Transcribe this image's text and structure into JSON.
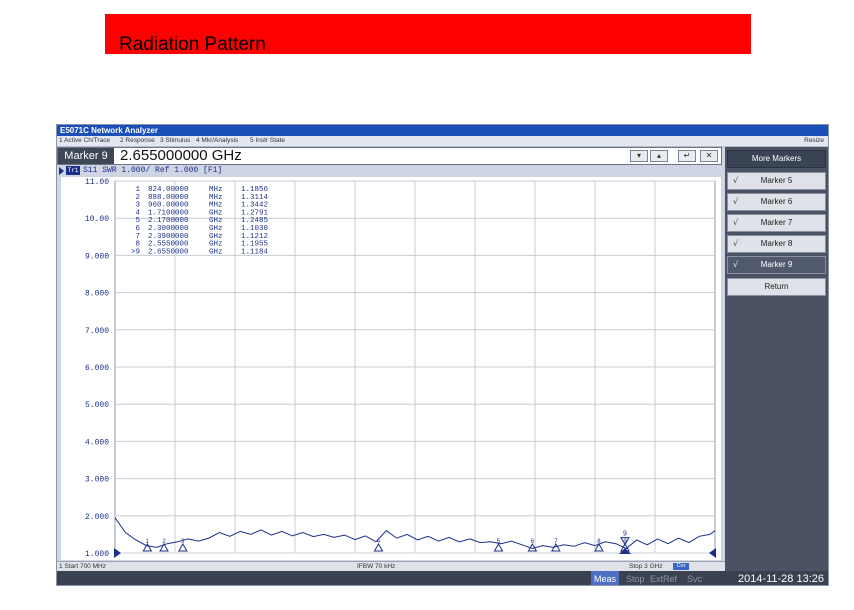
{
  "slide": {
    "title": "Radiation   Pattern"
  },
  "window": {
    "title": "E5071C Network Analyzer",
    "resize_label": "Resize"
  },
  "menu": [
    "1 Active Ch/Trace",
    "2 Response",
    "3 Stimulus",
    "4 Mkr/Analysis",
    "5 Instr State"
  ],
  "entry": {
    "label": "Marker 9",
    "value": "2.655000000 GHz"
  },
  "softkeys": {
    "title": "More Markers",
    "items": [
      {
        "check": "√",
        "label": "Marker 5",
        "active": false
      },
      {
        "check": "√",
        "label": "Marker 6",
        "active": false
      },
      {
        "check": "√",
        "label": "Marker 7",
        "active": false
      },
      {
        "check": "√",
        "label": "Marker 8",
        "active": false
      },
      {
        "check": "√",
        "label": "Marker 9",
        "active": true
      }
    ],
    "return_label": "Return"
  },
  "trace": {
    "badge": "Tr1",
    "header_text": "S11  SWR 1.000/ Ref 1.000 [F1]"
  },
  "markers_table": [
    {
      "num": "1",
      "freq": "824.00000",
      "unit": "MHz",
      "value": "1.1856"
    },
    {
      "num": "2",
      "freq": "888.00000",
      "unit": "MHz",
      "value": "1.3114"
    },
    {
      "num": "3",
      "freq": "960.00000",
      "unit": "MHz",
      "value": "1.3442"
    },
    {
      "num": "4",
      "freq": "1.7100000",
      "unit": "GHz",
      "value": "1.2791"
    },
    {
      "num": "5",
      "freq": "2.1700000",
      "unit": "GHz",
      "value": "1.2485"
    },
    {
      "num": "6",
      "freq": "2.3000000",
      "unit": "GHz",
      "value": "1.1030"
    },
    {
      "num": "7",
      "freq": "2.3900000",
      "unit": "GHz",
      "value": "1.1212"
    },
    {
      "num": "8",
      "freq": "2.5550000",
      "unit": "GHz",
      "value": "1.1955"
    },
    {
      "num": ">9",
      "freq": "2.6550000",
      "unit": "GHz",
      "value": "1.1184"
    }
  ],
  "status": {
    "start": "1  Start 700 MHz",
    "ifbw": "IFBW 70 kHz",
    "stop": "Stop 3 GHz",
    "cor": "Cor"
  },
  "bottom": {
    "meas": "Meas",
    "indicators": [
      "Stop",
      "ExtRef",
      "Svc"
    ],
    "datetime": "2014-11-28 13:26"
  },
  "chart_data": {
    "type": "line",
    "title": "",
    "xlabel": "",
    "ylabel": "",
    "x_unit": "GHz",
    "xlim": [
      0.7,
      3.0
    ],
    "ylim": [
      1.0,
      11.0
    ],
    "y_ticks": [
      11.0,
      10.0,
      9.0,
      8.0,
      7.0,
      6.0,
      5.0,
      4.0,
      3.0,
      2.0,
      1.0
    ],
    "y_tick_labels": [
      "11.00",
      "10.00",
      "9.000",
      "8.000",
      "7.000",
      "6.000",
      "5.000",
      "4.000",
      "3.000",
      "2.000",
      "1.000"
    ],
    "grid": true,
    "series": [
      {
        "color": "#1c2f8a",
        "x": [
          0.7,
          0.74,
          0.78,
          0.82,
          0.86,
          0.9,
          0.94,
          0.98,
          1.02,
          1.06,
          1.1,
          1.14,
          1.18,
          1.22,
          1.26,
          1.3,
          1.34,
          1.38,
          1.42,
          1.46,
          1.5,
          1.54,
          1.58,
          1.62,
          1.66,
          1.7,
          1.74,
          1.78,
          1.82,
          1.86,
          1.9,
          1.94,
          1.98,
          2.02,
          2.06,
          2.1,
          2.14,
          2.18,
          2.22,
          2.26,
          2.3,
          2.34,
          2.38,
          2.42,
          2.46,
          2.5,
          2.54,
          2.58,
          2.62,
          2.66,
          2.7,
          2.74,
          2.78,
          2.82,
          2.86,
          2.9,
          2.94,
          2.98,
          3.0
        ],
        "y": [
          1.95,
          1.55,
          1.35,
          1.2,
          1.15,
          1.25,
          1.3,
          1.38,
          1.32,
          1.4,
          1.55,
          1.45,
          1.58,
          1.5,
          1.62,
          1.48,
          1.58,
          1.46,
          1.55,
          1.44,
          1.5,
          1.42,
          1.48,
          1.36,
          1.46,
          1.3,
          1.6,
          1.4,
          1.5,
          1.35,
          1.45,
          1.32,
          1.42,
          1.3,
          1.38,
          1.28,
          1.3,
          1.25,
          1.32,
          1.22,
          1.12,
          1.2,
          1.15,
          1.22,
          1.18,
          1.28,
          1.2,
          1.3,
          1.25,
          1.12,
          1.35,
          1.22,
          1.38,
          1.25,
          1.4,
          1.28,
          1.45,
          1.5,
          1.6
        ]
      }
    ],
    "markers": [
      {
        "label": "1",
        "x": 0.824,
        "y": 1.1856
      },
      {
        "label": "2",
        "x": 0.888,
        "y": 1.3114
      },
      {
        "label": "3",
        "x": 0.96,
        "y": 1.3442
      },
      {
        "label": "4",
        "x": 1.71,
        "y": 1.2791
      },
      {
        "label": "5",
        "x": 2.17,
        "y": 1.2485
      },
      {
        "label": "6",
        "x": 2.3,
        "y": 1.103
      },
      {
        "label": "7",
        "x": 2.39,
        "y": 1.1212
      },
      {
        "label": "8",
        "x": 2.555,
        "y": 1.1955
      },
      {
        "label": "9",
        "x": 2.655,
        "y": 1.1184
      }
    ],
    "reference_level": 1.0
  }
}
